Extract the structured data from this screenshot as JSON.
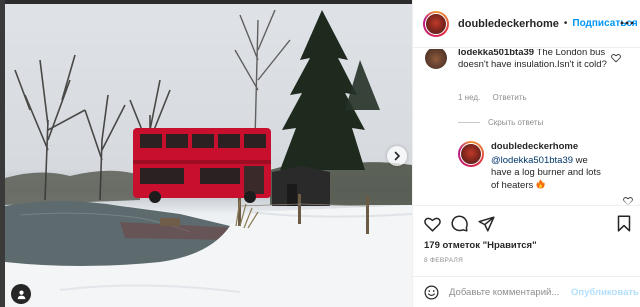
{
  "post": {
    "author": "doubledeckerhome",
    "follow_label": "Подписаться",
    "separator": "•"
  },
  "comments": {
    "first": {
      "username": "lodekka501bta39",
      "text": "The London bus doesn't have insulation.Isn't it cold?",
      "time": "1 нед.",
      "reply_label": "Ответить"
    },
    "hide_replies_label": "Скрыть ответы",
    "reply": {
      "username": "doubledeckerhome",
      "mention": "@lodekka501bta39",
      "text": " we have a log burner and lots of heaters "
    }
  },
  "actions": {
    "likes_text": "179 отметок \"Нравится\"",
    "date": "8 февраля"
  },
  "composer": {
    "placeholder": "Добавьте комментарий...",
    "publish_label": "Опубликовать"
  },
  "colors": {
    "accent": "#0095f6",
    "bus_red": "#c8102e",
    "publish_disabled": "#b2dffc"
  },
  "icons": [
    "chevron-right-icon",
    "user-tag-icon",
    "more-icon",
    "heart-icon",
    "comment-icon",
    "share-icon",
    "bookmark-icon",
    "smiley-icon",
    "fire-emoji"
  ]
}
